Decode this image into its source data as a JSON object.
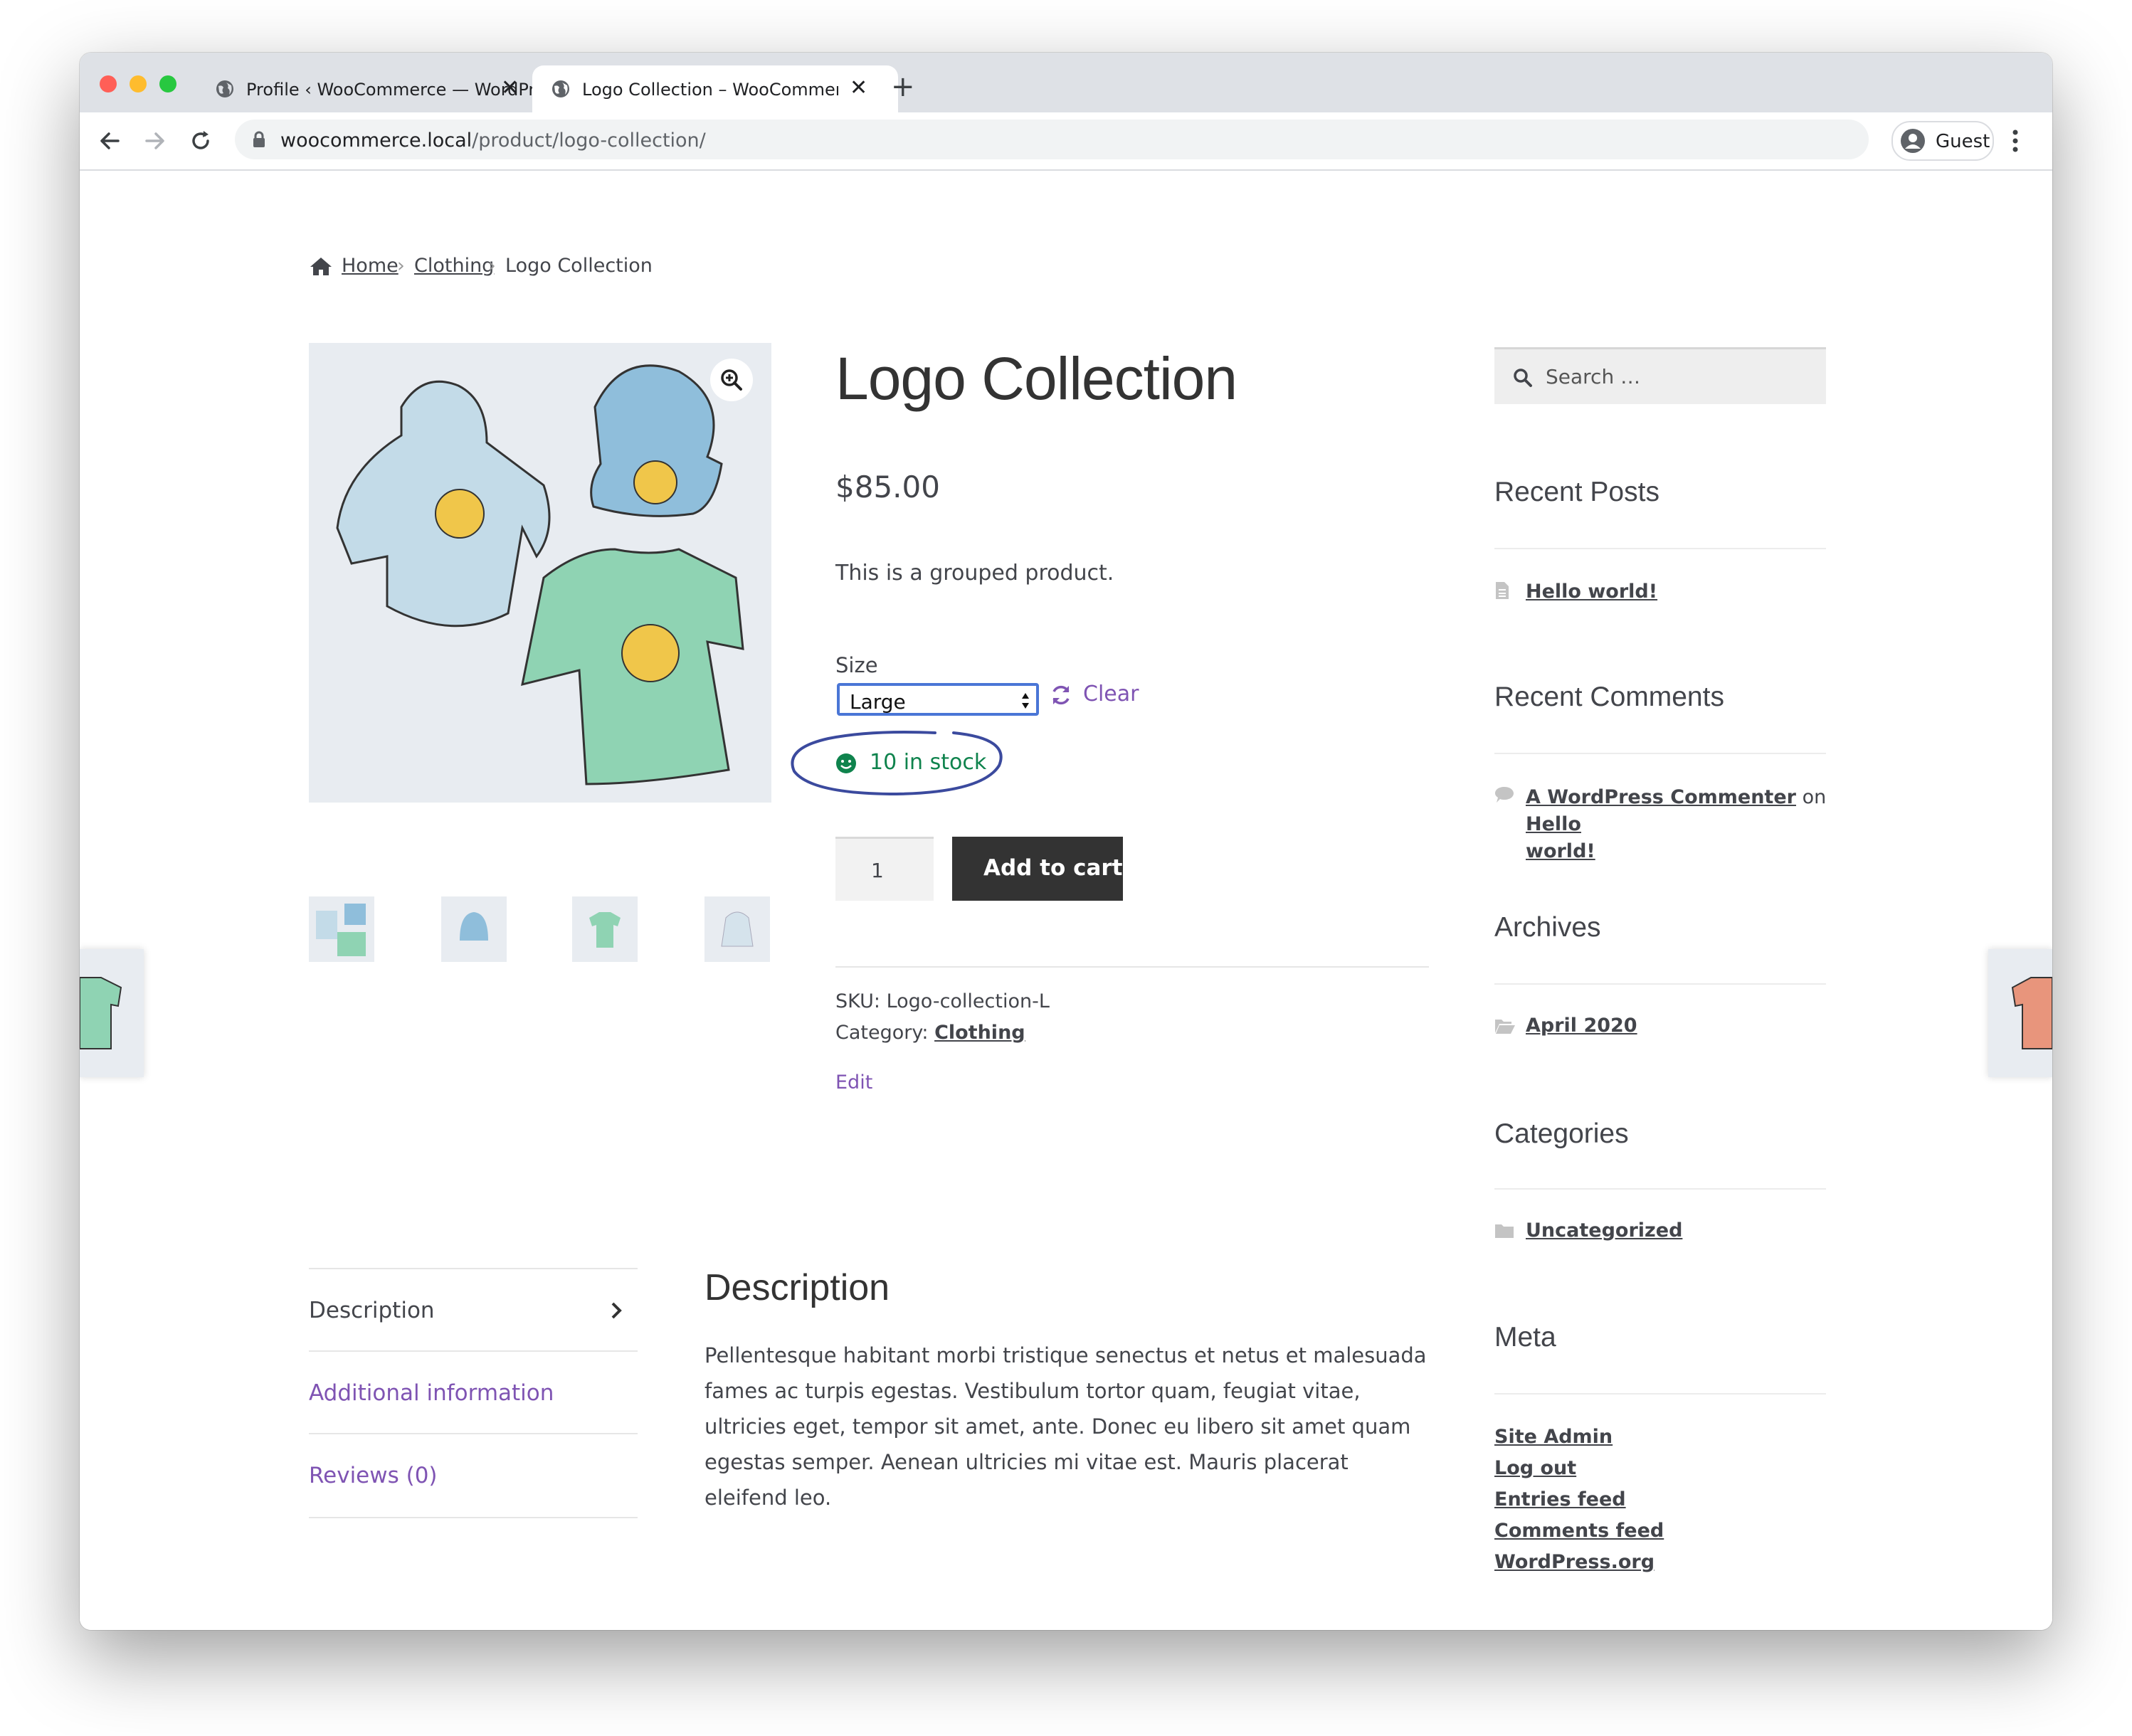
{
  "browser": {
    "tabs": [
      {
        "title": "Profile ‹ WooCommerce — WordPress",
        "active": false
      },
      {
        "title": "Logo Collection – WooCommerce",
        "active": true
      }
    ],
    "url_host": "woocommerce.local",
    "url_path": "/product/logo-collection/",
    "profile_label": "Guest"
  },
  "breadcrumb": {
    "home": "Home",
    "category": "Clothing",
    "current": "Logo Collection"
  },
  "product": {
    "title": "Logo Collection",
    "price": "$85.00",
    "short_description": "This is a grouped product.",
    "size_label": "Size",
    "size_selected": "Large",
    "clear_label": "Clear",
    "stock": "10 in stock",
    "quantity": "1",
    "add_to_cart": "Add to cart",
    "sku_label": "SKU:",
    "sku": "Logo-collection-L",
    "category_label": "Category:",
    "category": "Clothing",
    "edit_label": "Edit"
  },
  "tabs": {
    "items": [
      "Description",
      "Additional information",
      "Reviews (0)"
    ],
    "active": "Description"
  },
  "description": {
    "heading": "Description",
    "body": "Pellentesque habitant morbi tristique senectus et netus et malesuada fames ac turpis egestas. Vestibulum tortor quam, feugiat vitae, ultricies eget, tempor sit amet, ante. Donec eu libero sit amet quam egestas semper. Aenean ultricies mi vitae est. Mauris placerat eleifend leo."
  },
  "sidebar": {
    "search_placeholder": "Search …",
    "recent_posts": {
      "heading": "Recent Posts",
      "items": [
        "Hello world!"
      ]
    },
    "recent_comments": {
      "heading": "Recent Comments",
      "author": "A WordPress Commenter",
      "on": "on",
      "post_line1": "Hello",
      "post_line2": "world!"
    },
    "archives": {
      "heading": "Archives",
      "items": [
        "April 2020"
      ]
    },
    "categories": {
      "heading": "Categories",
      "items": [
        "Uncategorized"
      ]
    },
    "meta": {
      "heading": "Meta",
      "items": [
        "Site Admin",
        "Log out",
        "Entries feed",
        "Comments feed",
        "WordPress.org"
      ]
    }
  },
  "colors": {
    "link_purple": "#7f54b3",
    "in_stock_green": "#0f834d",
    "button_dark": "#333333",
    "annotation_blue": "#3b4a9e"
  },
  "icons": [
    "home-icon",
    "search-icon",
    "zoom-icon",
    "refresh-icon",
    "smiley-icon",
    "document-icon",
    "comment-icon",
    "folder-icon",
    "chevron-right-icon",
    "lock-icon",
    "globe-icon",
    "user-icon"
  ]
}
